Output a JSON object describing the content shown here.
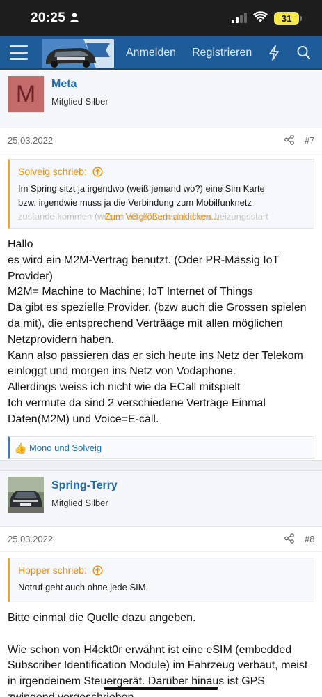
{
  "status_bar": {
    "time": "20:25",
    "battery": "31"
  },
  "navbar": {
    "login": "Anmelden",
    "register": "Registrieren"
  },
  "posts": [
    {
      "author": "Meta",
      "avatar_letter": "M",
      "user_title": "Mitglied Silber",
      "date": "25.03.2022",
      "number": "#7",
      "quote": {
        "author": "Solveig schrieb:",
        "lines": [
          "Im Spring sitzt ja irgendwo (weiß jemand wo?) eine Sim Karte",
          "bzw. irgendwie muss ja die Verbindung zum Mobilfunknetz",
          "zustande kommen (wegen eCall, Ladestand und heizungsstart"
        ],
        "expand": "Zum Vergrößern anklicken..."
      },
      "message_lines": [
        "Hallo",
        "es wird ein M2M-Vertrag benutzt. (Oder PR-Mässig IoT",
        "Provider)",
        "M2M= Machine to Machine; IoT Internet of Things",
        "Da gibt es spezielle Provider, (bzw auch die Grossen spielen",
        "da mit), die entsprechend Verträäge mit allen möglichen",
        "Netzprovidern haben.",
        "Kann also passieren das er sich heute ins Netz der Telekom",
        "einloggt und morgen ins Netz von Vodaphone.",
        "Allerdings weiss ich nicht wie da ECall mitspielt",
        "Ich vermute da sind 2 verschiedene Verträge Einmal",
        "Daten(M2M) und Voice=E-call."
      ],
      "reactions": "Mono und Solveig"
    },
    {
      "author": "Spring-Terry",
      "user_title": "Mitglied Silber",
      "date": "25.03.2022",
      "number": "#8",
      "quote": {
        "author": "Hopper schrieb:",
        "lines": [
          "Notruf geht auch ohne jede SIM."
        ]
      },
      "message_lines": [
        "Bitte einmal die Quelle dazu angeben.",
        "",
        "Wie schon von H4ckt0r erwähnt ist eine eSIM (embedded",
        "Subscriber Identification Module) im Fahrzeug verbaut, meist",
        "in irgendeinem Steuergerät. Darüber hinaus ist GPS",
        "zwingend vorgeschrieben"
      ]
    }
  ],
  "colors": {
    "navbar": "#1e5c99",
    "link": "#1e6bb1",
    "quote_accent": "#f2a11c",
    "reaction_accent": "#3d7bc0",
    "avatar_m": "#c36b6b"
  },
  "icons": [
    "person-icon",
    "signal-icon",
    "wifi-icon",
    "menu-icon",
    "bolt-icon",
    "search-icon",
    "share-icon",
    "arrow-up-circle-icon",
    "thumbs-up-icon"
  ]
}
